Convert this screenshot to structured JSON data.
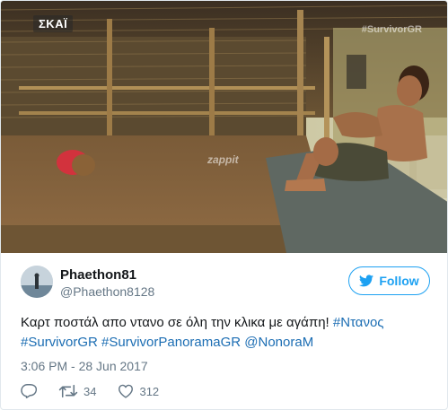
{
  "media": {
    "channel_logo": "ΣΚΑΪ",
    "watermark_hashtag": "#SurvivorGR",
    "watermark_brand": "zappit"
  },
  "tweet": {
    "display_name": "Phaethon81",
    "handle": "@Phaethon8128",
    "follow_label": "Follow",
    "text_plain": "Καρτ ποστάλ απο ντανο σε όλη την κλικα με αγάπη! ",
    "hashtags": [
      "#Ντανος",
      "#SurvivorGR",
      "#SurvivorPanoramaGR"
    ],
    "mention": "@NonoraM",
    "timestamp": "3:06 PM - 28 Jun 2017",
    "retweet_count": "34",
    "like_count": "312"
  },
  "colors": {
    "accent": "#1da1f2",
    "link": "#1b6db3",
    "muted": "#657786",
    "text": "#14171a"
  },
  "icons": {
    "reply": "reply-icon",
    "retweet": "retweet-icon",
    "like": "heart-icon",
    "follow": "bird-icon"
  }
}
